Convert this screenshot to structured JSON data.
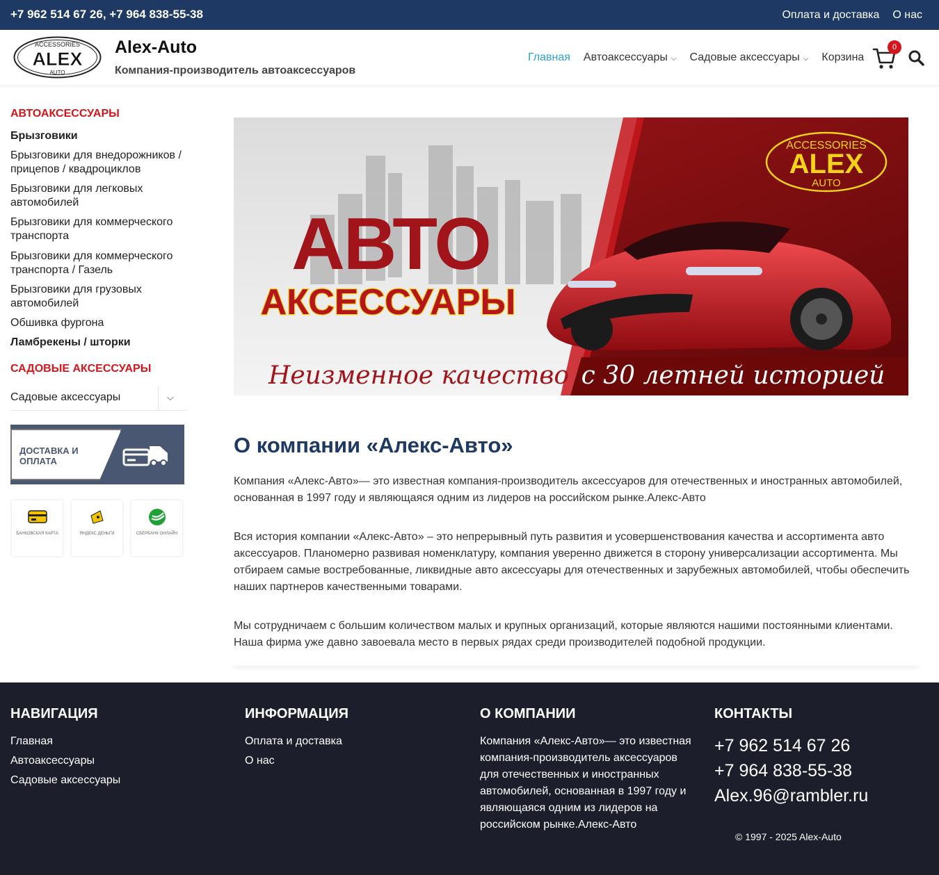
{
  "topbar": {
    "phones": "+7 962 514 67 26, +7 964 838-55-38",
    "links": [
      "Оплата и доставка",
      "О нас"
    ]
  },
  "header": {
    "logo": {
      "top": "ACCESSORIES",
      "main": "ALEX",
      "bottom": "AUTO"
    },
    "title": "Alex-Auto",
    "description": "Компания-производитель автоаксессуаров",
    "nav": [
      "Главная",
      "Автоаксессуары",
      "Садовые аксессуары",
      "Корзина"
    ],
    "cart_count": "0"
  },
  "sidebar": {
    "heading1": "АВТОАКСЕССУАРЫ",
    "items": [
      "Брызговики",
      "Брызговики для внедорожников / прицепов / квадроциклов",
      "Брызговики для легковых автомобилей",
      "Брызговики для коммерческого транспорта",
      "Брызговики для коммерческого транспорта / Газель",
      "Брызговики для грузовых автомобилей",
      "Обшивка фургона",
      "Ламбрекены / шторки"
    ],
    "heading2": "САДОВЫЕ АКСЕССУАРЫ",
    "select_value": "Садовые аксессуары",
    "delivery_text": "ДОСТАВКА и ОПЛАТА",
    "payments": [
      "БАНКОВСКАЯ КАРТА",
      "ЯНДЕКС ДЕНЬГИ",
      "СБЕРБАНК ОНЛАЙН"
    ]
  },
  "banner": {
    "big": "АВТО",
    "sub": "АКСЕССУАРЫ",
    "slogan_left": "Неизменное качество",
    "slogan_right": "с 30 летней историей",
    "logo_top": "ACCESSORIES",
    "logo_main": "ALEX",
    "logo_bottom": "AUTO"
  },
  "main": {
    "title": "О компании «Алекс-Авто»",
    "p1": "Компания «Алекс-Авто»— это известная компания-производитель аксессуаров для отечественных и иностранных автомобилей, основанная в 1997 году и являющаяся одним из лидеров на российском рынке.Алекс-Авто",
    "p2": "Вся история компании «Алекс-Авто» – это непрерывный путь развития и усовершенствования качества и ассортимента авто аксессуаров. Планомерно развивая номенклатуру, компания уверенно движется в сторону универсализации ассортимента. Мы отбираем самые востребованные, ликвидные авто аксессуары для отечественных и зарубежных автомобилей, чтобы обеспечить наших партнеров качественными товарами.",
    "p3": "Мы сотрудничаем с большим количеством малых и крупных организаций, которые являются нашими постоянными клиентами. Наша фирма уже давно завоевала место в первых рядах среди производителей подобной продукции."
  },
  "footer": {
    "nav_heading": "НАВИГАЦИЯ",
    "nav_links": [
      "Главная",
      "Автоаксессуары",
      "Садовые аксессуары"
    ],
    "info_heading": "ИНФОРМАЦИЯ",
    "info_links": [
      "Оплата и доставка",
      "О нас"
    ],
    "about_heading": "О КОМПАНИИ",
    "about_text": "Компания «Алекс-Авто»— это известная компания-производитель аксессуаров для отечественных и иностранных автомобилей, основанная в 1997 году и являющаяся одним из лидеров на российском рынке.Алекс-Авто",
    "contacts_heading": "КОНТАКТЫ",
    "contacts": [
      "+7 962 514 67 26",
      "+7 964 838-55-38",
      "Alex.96@rambler.ru"
    ],
    "copyright": "© 1997 - 2025 Alex-Auto"
  },
  "colors": {
    "topbar": "#1e3a64",
    "accent_red": "#d4161c",
    "nav_active": "#2aa3d6",
    "footer": "#1c1f2b"
  }
}
